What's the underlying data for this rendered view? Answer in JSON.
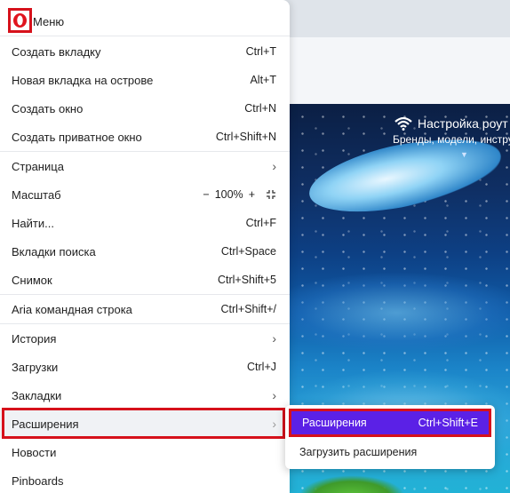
{
  "menu": {
    "title": "Меню",
    "items": [
      {
        "label": "Создать вкладку",
        "shortcut": "Ctrl+T"
      },
      {
        "label": "Новая вкладка на острове",
        "shortcut": "Alt+T"
      },
      {
        "label": "Создать окно",
        "shortcut": "Ctrl+N"
      },
      {
        "label": "Создать приватное окно",
        "shortcut": "Ctrl+Shift+N"
      },
      {
        "label": "Страница"
      },
      {
        "label": "Масштаб",
        "zoom_minus": "−",
        "zoom_value": "100%",
        "zoom_plus": "+"
      },
      {
        "label": "Найти...",
        "shortcut": "Ctrl+F"
      },
      {
        "label": "Вкладки поиска",
        "shortcut": "Ctrl+Space"
      },
      {
        "label": "Снимок",
        "shortcut": "Ctrl+Shift+5"
      },
      {
        "label": "Aria командная строка",
        "shortcut": "Ctrl+Shift+/"
      },
      {
        "label": "История"
      },
      {
        "label": "Загрузки",
        "shortcut": "Ctrl+J"
      },
      {
        "label": "Закладки"
      },
      {
        "label": "Расширения"
      },
      {
        "label": "Новости"
      },
      {
        "label": "Pinboards"
      }
    ]
  },
  "submenu": {
    "items": [
      {
        "label": "Расширения",
        "shortcut": "Ctrl+Shift+E"
      },
      {
        "label": "Загрузить расширения"
      }
    ]
  },
  "speed_dial": {
    "title": "Настройка роут",
    "subtitle": "Бренды, модели, инстру"
  },
  "colors": {
    "highlight_red": "#d6111b",
    "submenu_active": "#5b21e6",
    "opera_red": "#e0141e"
  },
  "icons": {
    "logo": "opera-logo",
    "chevron": "chevron-right-icon",
    "fullscreen": "fullscreen-icon",
    "wifi": "wifi-icon"
  }
}
